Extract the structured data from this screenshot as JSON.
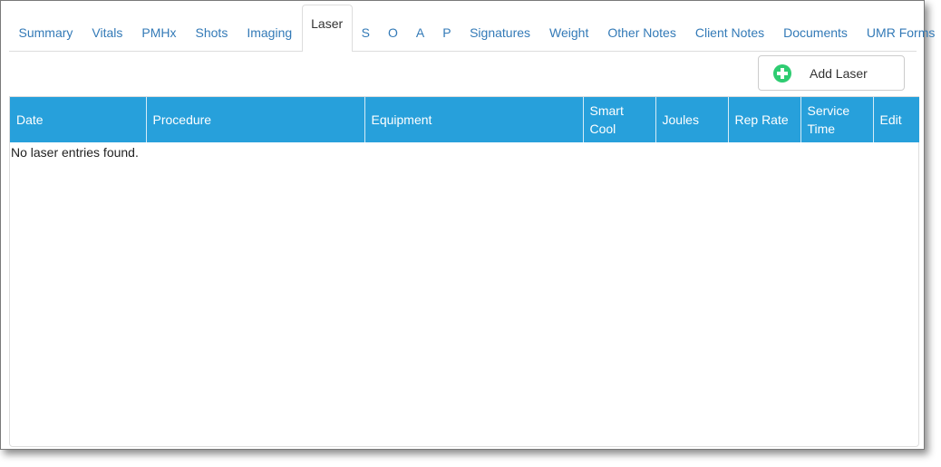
{
  "tabs": [
    {
      "label": "Summary",
      "active": false
    },
    {
      "label": "Vitals",
      "active": false
    },
    {
      "label": "PMHx",
      "active": false
    },
    {
      "label": "Shots",
      "active": false
    },
    {
      "label": "Imaging",
      "active": false
    },
    {
      "label": "Laser",
      "active": true
    },
    {
      "label": "S",
      "active": false
    },
    {
      "label": "O",
      "active": false
    },
    {
      "label": "A",
      "active": false
    },
    {
      "label": "P",
      "active": false
    },
    {
      "label": "Signatures",
      "active": false
    },
    {
      "label": "Weight",
      "active": false
    },
    {
      "label": "Other Notes",
      "active": false
    },
    {
      "label": "Client Notes",
      "active": false
    },
    {
      "label": "Documents",
      "active": false
    },
    {
      "label": "UMR Forms",
      "active": false
    }
  ],
  "toolbar": {
    "add_label": "Add Laser",
    "add_icon": "plus-circle-icon",
    "add_icon_color": "#2ecc71"
  },
  "table": {
    "header_color": "#27a0db",
    "columns": [
      {
        "line1": "Date",
        "line2": ""
      },
      {
        "line1": "Procedure",
        "line2": ""
      },
      {
        "line1": "Equipment",
        "line2": ""
      },
      {
        "line1": "Smart",
        "line2": "Cool"
      },
      {
        "line1": "Joules",
        "line2": ""
      },
      {
        "line1": "Rep Rate",
        "line2": ""
      },
      {
        "line1": "Service",
        "line2": "Time"
      },
      {
        "line1": "Edit",
        "line2": ""
      }
    ],
    "rows": [],
    "empty_message": "No laser entries found."
  }
}
